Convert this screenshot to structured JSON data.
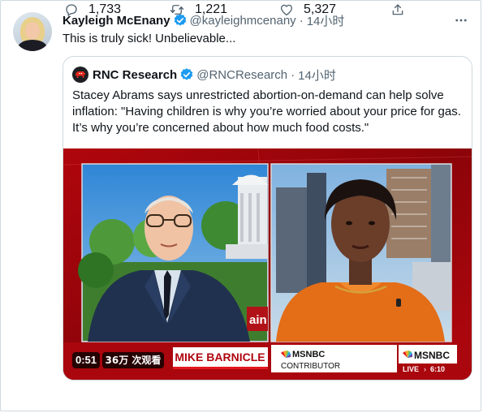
{
  "tweet": {
    "author_name": "Kayleigh McEnany",
    "author_handle": "@kayleighmcenany",
    "separator": "·",
    "time": "14小时",
    "text": "This is truly sick! Unbelievable..."
  },
  "quoted": {
    "author_name": "RNC Research",
    "author_handle": "@RNCResearch",
    "separator": "·",
    "time": "14小时",
    "text": "Stacey Abrams says unrestricted abortion-on-demand can help solve inflation: \"Having children is why you’re worried about your price for gas. It’s why you’re concerned about how much food costs.\"",
    "video": {
      "duration": "0:51",
      "views": "36万 次观看",
      "lower_third_name": "MIKE BARNICLE",
      "lower_third_network": "MSNBC",
      "lower_third_role": "CONTRIBUTOR",
      "corner_network": "MSNBC",
      "live_label": "LIVE",
      "clock": "6:10",
      "backdrop_partial_text": "ain"
    }
  },
  "actions": {
    "reply_count": "1,733",
    "retweet_count": "1,221",
    "like_count": "5,327"
  },
  "icons": {
    "verified": "verified-badge-icon",
    "more": "more-options-icon",
    "reply": "reply-icon",
    "retweet": "retweet-icon",
    "like": "heart-icon",
    "share": "share-icon"
  },
  "colors": {
    "verified_blue": "#1d9bf0",
    "text_primary": "#0f1419",
    "text_secondary": "#536471",
    "border": "#cfd9de",
    "msnbc_red": "#c8102e"
  }
}
